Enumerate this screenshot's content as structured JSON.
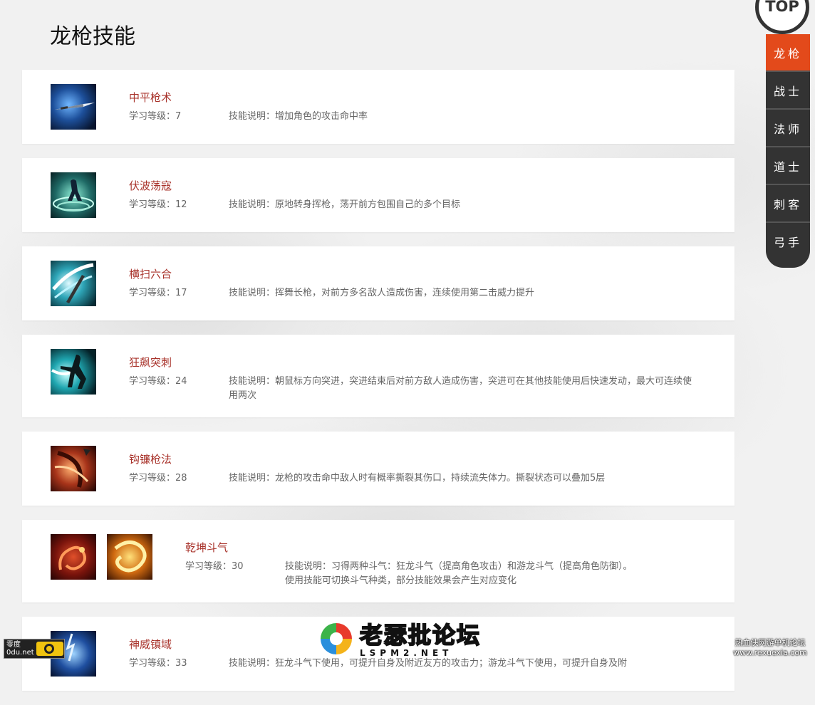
{
  "page_title": "龙枪技能",
  "nav": {
    "top_label": "TOP",
    "items": [
      {
        "label": "龙枪",
        "active": true
      },
      {
        "label": "战士",
        "active": false
      },
      {
        "label": "法师",
        "active": false
      },
      {
        "label": "道士",
        "active": false
      },
      {
        "label": "刺客",
        "active": false
      },
      {
        "label": "弓手",
        "active": false
      }
    ]
  },
  "skills": [
    {
      "name": "中平枪术",
      "level": "学习等级：7",
      "desc": "技能说明：增加角色的攻击命中率",
      "icons": [
        "spear-thrust-icon"
      ]
    },
    {
      "name": "伏波荡寇",
      "level": "学习等级：12",
      "desc": "技能说明：原地转身挥枪，荡开前方包围自己的多个目标",
      "icons": [
        "wave-spin-icon"
      ]
    },
    {
      "name": "横扫六合",
      "level": "学习等级：17",
      "desc": "技能说明：挥舞长枪，对前方多名敌人造成伤害，连续使用第二击威力提升",
      "icons": [
        "sweep-slash-icon"
      ]
    },
    {
      "name": "狂飙突刺",
      "level": "学习等级：24",
      "desc": "技能说明：朝鼠标方向突进，突进结束后对前方敌人造成伤害，突进可在其他技能使用后快速发动，最大可连续使用两次",
      "icons": [
        "dash-thrust-icon"
      ]
    },
    {
      "name": "钩镰枪法",
      "level": "学习等级：28",
      "desc": "技能说明：龙枪的攻击命中敌人时有概率撕裂其伤口，持续流失体力。撕裂状态可以叠加5层",
      "icons": [
        "hook-spear-icon"
      ]
    },
    {
      "name": "乾坤斗气",
      "level": "学习等级：30",
      "desc": "技能说明：习得两种斗气：狂龙斗气（提高角色攻击）和游龙斗气（提高角色防御）。使用技能可切换斗气种类，部分技能效果会产生对应变化",
      "icons": [
        "raging-dragon-icon",
        "roaming-dragon-icon"
      ]
    },
    {
      "name": "神威镇域",
      "level": "学习等级：33",
      "desc": "技能说明：狂龙斗气下使用，可提升自身及附近友方的攻击力；游龙斗气下使用，可提升自身及附",
      "icons": [
        "divine-domain-icon"
      ]
    }
  ],
  "watermarks": {
    "left_line1": "零度",
    "left_line2": "0du.net",
    "center_title": "老瑟批论坛",
    "center_sub": "LSPM2.NET",
    "right_line1": "热血侠网游单机论坛",
    "right_line2": "www.rexuexia.com"
  },
  "colors": {
    "accent": "#e34a1b",
    "skill_name": "#a8322a",
    "nav_bg": "#333333"
  }
}
